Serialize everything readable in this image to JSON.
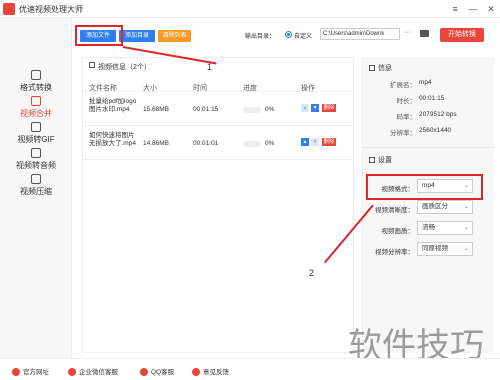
{
  "app": {
    "title": "优速视频处理大师"
  },
  "window_controls": {
    "menu": "≡",
    "minimize": "—",
    "close": "✕"
  },
  "sidebar": {
    "items": [
      {
        "label": "格式转换",
        "icon": "convert-icon",
        "active": false
      },
      {
        "label": "视频合并",
        "icon": "merge-icon",
        "active": true
      },
      {
        "label": "视频转GIF",
        "icon": "gif-icon",
        "active": false
      },
      {
        "label": "视频转音频",
        "icon": "audio-icon",
        "active": false
      },
      {
        "label": "视频压缩",
        "icon": "compress-icon",
        "active": false
      }
    ]
  },
  "toolbar": {
    "add_file": "添加文件",
    "add_folder": "添加目录",
    "clear_list": "清除列表",
    "output_label": "输出目录：",
    "custom_label": "自定义",
    "output_path": "C:\\Users\\admin\\Downk",
    "more": "···",
    "start": "开始转换"
  },
  "video_panel": {
    "title": "视频信息（2个）",
    "columns": [
      "文件名称",
      "大小",
      "时间",
      "进度",
      "操作"
    ],
    "rows": [
      {
        "name": "批量给pdf加logo图片水印.mp4",
        "size": "15.68MB",
        "time": "00:01:15",
        "progress": "0%",
        "delete": "删除"
      },
      {
        "name": "如何快速将图片无损放大了.mp4",
        "size": "14.86MB",
        "time": "00:01:01",
        "progress": "0%",
        "delete": "删除"
      }
    ]
  },
  "info": {
    "title": "信息",
    "fields": [
      {
        "label": "扩展名：",
        "value": "mp4"
      },
      {
        "label": "时长：",
        "value": "00:01:15"
      },
      {
        "label": "码率：",
        "value": "2079512 bps"
      },
      {
        "label": "分辨率：",
        "value": "2560x1440"
      }
    ]
  },
  "settings": {
    "title": "设置",
    "fields": [
      {
        "label": "视频格式：",
        "value": "mp4"
      },
      {
        "label": "视频清晰度：",
        "value": "画质区分"
      },
      {
        "label": "视频画质：",
        "value": "流畅"
      },
      {
        "label": "视频分辨率：",
        "value": "同原视频"
      }
    ]
  },
  "annotations": {
    "callout_1": "1",
    "callout_2": "2"
  },
  "footer": {
    "items": [
      "官方网址",
      "企业微信客服",
      "QQ客服",
      "意见反馈"
    ]
  },
  "watermark": "软件技巧",
  "colors": {
    "accent_red": "#e8463a",
    "accent_blue": "#2f7df0",
    "accent_orange": "#f59a23",
    "annotation_red": "#e0242c"
  }
}
